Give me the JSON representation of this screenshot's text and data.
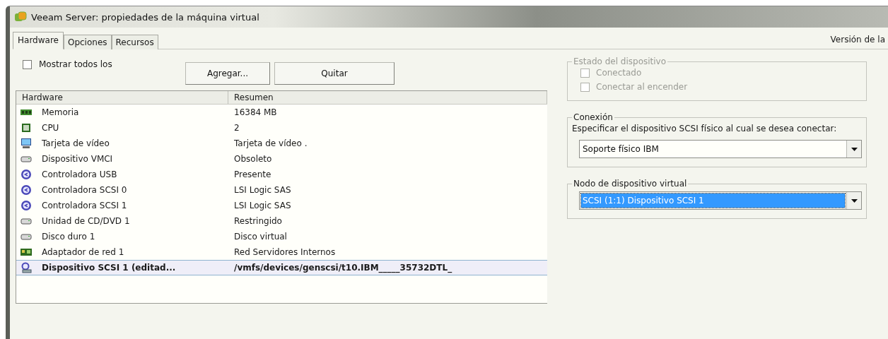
{
  "window": {
    "title": "Veeam Server: propiedades de la máquina virtual"
  },
  "tabs": [
    {
      "label": "Hardware",
      "selected": true
    },
    {
      "label": "Opciones",
      "selected": false
    },
    {
      "label": "Recursos",
      "selected": false
    }
  ],
  "version_label": "Versión de la",
  "show_all": {
    "label": "Mostrar todos los",
    "checked": false
  },
  "buttons": [
    "Agregar...",
    "Quitar"
  ],
  "table": {
    "columns": [
      "Hardware",
      "Resumen"
    ],
    "rows": [
      {
        "kind": "memory",
        "name": "Memoria",
        "summary": "16384 MB",
        "selected": false
      },
      {
        "kind": "cpu",
        "name": "CPU",
        "summary": "2",
        "selected": false
      },
      {
        "kind": "monitor",
        "name": "Tarjeta de vídeo",
        "summary": "Tarjeta de vídeo .",
        "selected": false
      },
      {
        "kind": "drive",
        "name": "Dispositivo VMCI",
        "summary": "Obsoleto",
        "selected": false
      },
      {
        "kind": "controller",
        "name": "Controladora USB",
        "summary": "Presente",
        "selected": false
      },
      {
        "kind": "controller",
        "name": "Controladora SCSI 0",
        "summary": "LSI Logic SAS",
        "selected": false
      },
      {
        "kind": "controller",
        "name": "Controladora SCSI 1",
        "summary": "LSI Logic SAS",
        "selected": false
      },
      {
        "kind": "drive",
        "name": "Unidad de CD/DVD 1",
        "summary": "Restringido",
        "selected": false
      },
      {
        "kind": "drive",
        "name": "Disco duro 1",
        "summary": "Disco virtual",
        "selected": false
      },
      {
        "kind": "network",
        "name": "Adaptador de red 1",
        "summary": "Red Servidores Internos",
        "selected": false
      },
      {
        "kind": "scsi",
        "name": "Dispositivo SCSI 1 (editad...",
        "summary": "/vmfs/devices/genscsi/t10.IBM_____35732DTL_",
        "selected": true
      }
    ]
  },
  "device_status": {
    "title": "Estado del dispositivo",
    "options": [
      {
        "label": "Conectado",
        "checked": false,
        "disabled": true
      },
      {
        "label": "Conectar al encender",
        "checked": false,
        "disabled": true
      }
    ]
  },
  "connection": {
    "title": "Conexión",
    "description": "Especificar el dispositivo SCSI físico al cual se desea conectar:",
    "value": "Soporte físico IBM"
  },
  "virtual_node": {
    "title": "Nodo de dispositivo virtual",
    "value": "SCSI (1:1) Dispositivo SCSI 1",
    "focused": true
  }
}
